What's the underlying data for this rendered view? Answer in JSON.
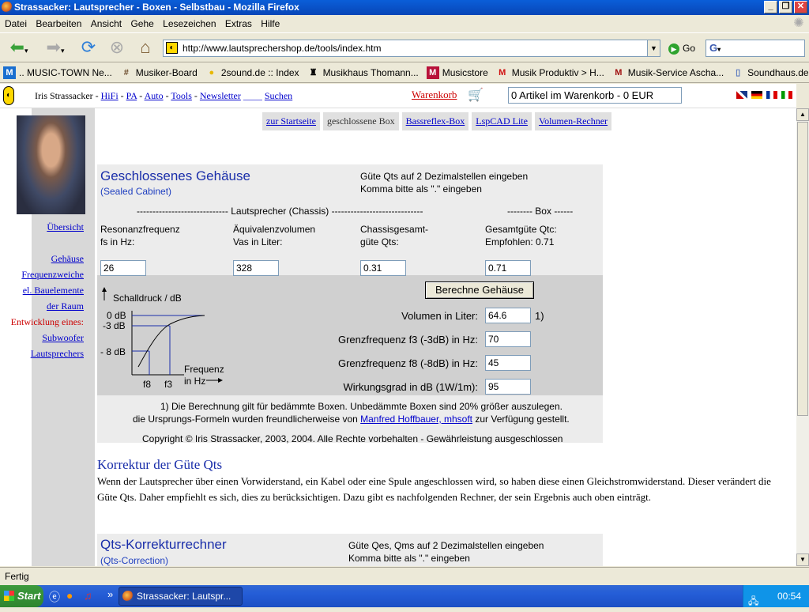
{
  "window": {
    "title": "Strassacker: Lautsprecher - Boxen - Selbstbau - Mozilla Firefox"
  },
  "menu": [
    "Datei",
    "Bearbeiten",
    "Ansicht",
    "Gehe",
    "Lesezeichen",
    "Extras",
    "Hilfe"
  ],
  "nav": {
    "url": "http://www.lautsprechershop.de/tools/index.htm",
    "go": "Go",
    "search": "G"
  },
  "bookmarks": [
    {
      "icon": "M",
      "label": ".. MUSIC-TOWN Ne..."
    },
    {
      "icon": "#",
      "label": "Musiker-Board"
    },
    {
      "icon": "●",
      "label": "2sound.de :: Index"
    },
    {
      "icon": "♜",
      "label": "Musikhaus Thomann..."
    },
    {
      "icon": "M",
      "label": "Musicstore"
    },
    {
      "icon": "M",
      "label": "Musik Produktiv > H..."
    },
    {
      "icon": "M",
      "label": "Musik-Service Ascha..."
    },
    {
      "icon": "▯",
      "label": "Soundhaus.de Musi..."
    }
  ],
  "site": {
    "brand": "Iris Strassacker",
    "sep": "-",
    "links": [
      "HiFi",
      "PA",
      "Auto",
      "Tools",
      "Newsletter"
    ],
    "gap": "____",
    "search": "Suchen",
    "cart": "Warenkorb",
    "cart_status": "0 Artikel im Warenkorb - 0 EUR"
  },
  "tabs": [
    "zur Startseite",
    "geschlossene Box",
    "Bassreflex-Box",
    "LspCAD Lite",
    "Volumen-Rechner"
  ],
  "left_nav": {
    "overview": "Übersicht",
    "items": [
      "Gehäuse",
      "Frequenzweiche",
      "el. Bauelemente",
      "der Raum"
    ],
    "red": "Entwicklung eines:",
    "items2": [
      "Subwoofer",
      "Lautsprechers"
    ]
  },
  "calc": {
    "title": "Geschlossenes Gehäuse",
    "subtitle": "(Sealed Cabinet)",
    "hint1": "Güte Qts auf 2 Dezimalstellen eingeben",
    "hint2": "Komma bitte als \".\" eingeben",
    "section_left": "----------------------------- Lautsprecher (Chassis) -----------------------------",
    "section_right": "-------- Box ------",
    "l1a": "Resonanzfrequenz",
    "l1b": "fs in Hz:",
    "l2a": "Äquivalenzvolumen",
    "l2b": "Vas in Liter:",
    "l3a": "Chassisgesamt-",
    "l3b": "güte Qts:",
    "l4a": "Gesamtgüte Qtc:",
    "l4b": "Empfohlen: 0.71",
    "fs": "26",
    "vas": "328",
    "qts": "0.31",
    "qtc": "0.71",
    "button": "Berechne Gehäuse",
    "r1": "Volumen in Liter:",
    "v1": "64.6",
    "note1": "1)",
    "r2": "Grenzfrequenz f3 (-3dB) in Hz:",
    "v2": "70",
    "r3": "Grenzfrequenz f8 (-8dB) in Hz:",
    "v3": "45",
    "r4": "Wirkungsgrad in dB (1W/1m):",
    "v4": "95",
    "graph": {
      "ylabel": "Schalldruck / dB",
      "t0": "0 dB",
      "t3": "-3 dB",
      "t8": "- 8 dB",
      "x1": "Frequenz",
      "x2": "in Hz",
      "f8": "f8",
      "f3": "f3"
    },
    "fn1": "1) Die Berechnung gilt für bedämmte Boxen. Unbedämmte Boxen sind 20% größer auszulegen.",
    "fn2a": "die Ursprungs-Formeln wurden freundlicherweise von",
    "fn2link": "Manfred Hoffbauer, mhsoft",
    "fn2b": "zur Verfügung gestellt.",
    "copy": "Copyright © Iris Strassacker, 2003, 2004. Alle Rechte vorbehalten - Gewährleistung ausgeschlossen"
  },
  "korrektur": {
    "title": "Korrektur der Güte Qts",
    "text": "Wenn der Lautsprecher über einen Vorwiderstand, ein Kabel oder eine Spule angeschlossen wird, so haben diese einen Gleichstromwiderstand. Dieser verändert die Güte Qts. Daher empfiehlt es sich, dies zu berücksichtigen. Dazu gibt es nachfolgenden Rechner, der sein Ergebnis auch oben einträgt."
  },
  "calc2": {
    "title": "Qts-Korrekturrechner",
    "subtitle": "(Qts-Correction)",
    "hint1": "Güte Qes, Qms auf 2 Dezimalstellen eingeben",
    "hint2": "Komma bitte als \".\" eingeben"
  },
  "status": "Fertig",
  "taskbar": {
    "start": "Start",
    "task": "Strassacker: Lautspr...",
    "clock": "00:54"
  }
}
